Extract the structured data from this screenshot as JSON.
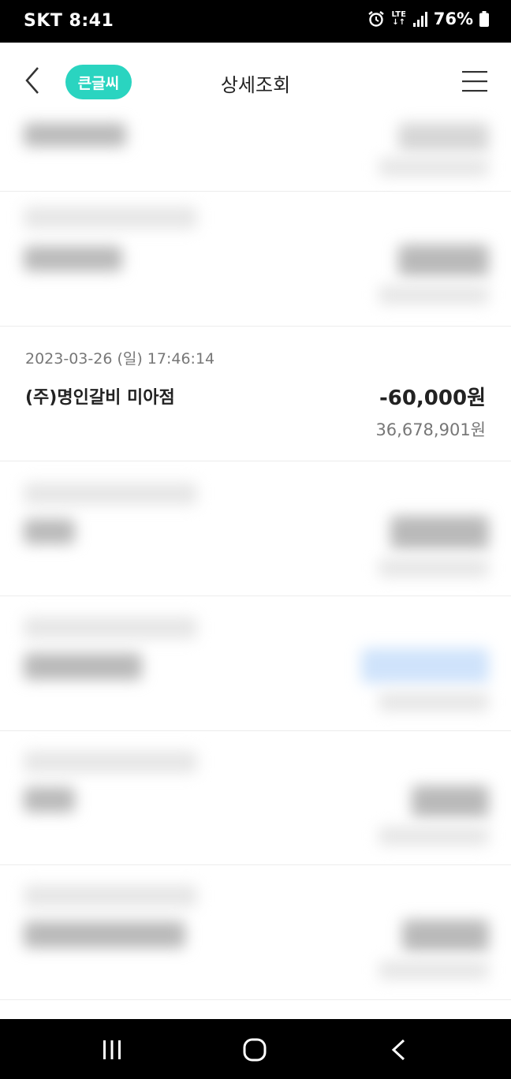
{
  "status_bar": {
    "carrier_time": "SKT 8:41",
    "network": "LTE",
    "battery": "76%"
  },
  "header": {
    "big_font_label": "큰글씨",
    "title": "상세조회"
  },
  "transaction": {
    "datetime": "2023-03-26 (일) 17:46:14",
    "merchant": "(주)명인갈비 미아점",
    "amount": "-60,000원",
    "balance": "36,678,901원"
  },
  "icons": {
    "back": "chevron-left-icon",
    "menu": "hamburger-menu-icon",
    "alarm": "alarm-clock-icon",
    "signal": "signal-icon",
    "battery": "battery-icon",
    "nav_recent": "recent-apps-icon",
    "nav_home": "home-icon",
    "nav_back": "back-icon"
  },
  "colors": {
    "accent": "#2ad4c0",
    "status_bar": "#000000",
    "nav_bar": "#000000"
  }
}
